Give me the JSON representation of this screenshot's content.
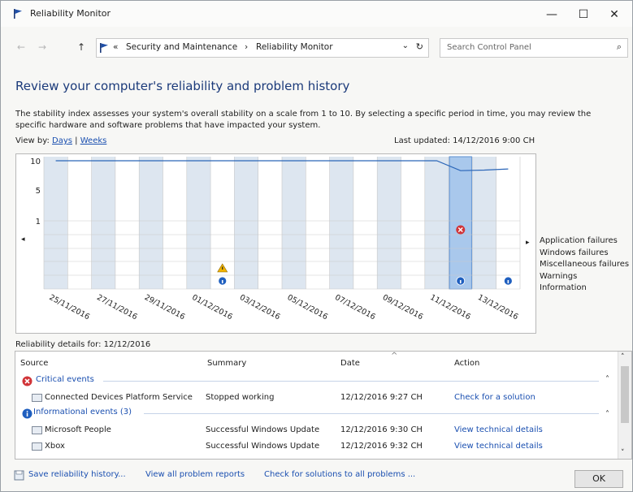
{
  "window": {
    "title": "Reliability Monitor",
    "minimize_glyph": "—",
    "maximize_glyph": "☐",
    "close_glyph": "✕"
  },
  "address": {
    "back_glyph": "←",
    "forward_glyph": "→",
    "up_glyph": "↑",
    "overflow": "«",
    "crumb1": "Security and Maintenance",
    "sep": "›",
    "crumb2": "Reliability Monitor",
    "dropdown_glyph": "⌄",
    "refresh_glyph": "↻",
    "search_placeholder": "Search Control Panel",
    "search_glyph": "⌕"
  },
  "page": {
    "heading": "Review your computer's reliability and problem history",
    "description": "The stability index assesses your system's overall stability on a scale from 1 to 10. By selecting a specific period in time, you may review the specific hardware and software problems that have impacted your system.",
    "view_by": "View by:",
    "days": "Days",
    "weeks": "Weeks",
    "sep": "|",
    "last_updated": "Last updated: 14/12/2016 9:00 CH"
  },
  "chart_data": {
    "type": "line",
    "y_ticks": [
      "10",
      "5",
      "1"
    ],
    "x_labels": [
      "25/11/2016",
      "27/11/2016",
      "29/11/2016",
      "01/12/2016",
      "03/12/2016",
      "05/12/2016",
      "07/12/2016",
      "09/12/2016",
      "11/12/2016",
      "13/12/2016"
    ],
    "num_days": 20,
    "stability": [
      10,
      10,
      10,
      10,
      10,
      10,
      10,
      10,
      10,
      10,
      10,
      10,
      10,
      10,
      10,
      10,
      10,
      8.3,
      8.4,
      8.6
    ],
    "selected_day_index": 17,
    "row_labels": [
      "Application failures",
      "Windows failures",
      "Miscellaneous failures",
      "Warnings",
      "Information"
    ],
    "events": [
      {
        "day": 7,
        "row": "Warnings",
        "kind": "warning"
      },
      {
        "day": 7,
        "row": "Information",
        "kind": "info"
      },
      {
        "day": 17,
        "row": "Application failures",
        "kind": "critical"
      },
      {
        "day": 17,
        "row": "Information",
        "kind": "info"
      },
      {
        "day": 19,
        "row": "Information",
        "kind": "info"
      }
    ],
    "colors": {
      "line": "#2b66b8",
      "shade": "#dde6f0",
      "selected": "#a9c8ec",
      "grid": "#c9c9c9"
    },
    "nav_left": "◂",
    "nav_right": "▸"
  },
  "details": {
    "label": "Reliability details for: 12/12/2016",
    "headers": {
      "source": "Source",
      "summary": "Summary",
      "date": "Date",
      "action": "Action"
    },
    "sort_glyph": "^",
    "critical_group": "Critical events",
    "info_group": "Informational events (3)",
    "collapse_glyph": "˄",
    "rows": [
      {
        "source": "Connected Devices Platform Service",
        "summary": "Stopped working",
        "date": "12/12/2016 9:27 CH",
        "action": "Check for a solution"
      },
      {
        "source": "Microsoft People",
        "summary": "Successful Windows Update",
        "date": "12/12/2016 9:30 CH",
        "action": "View  technical details"
      },
      {
        "source": "Xbox",
        "summary": "Successful Windows Update",
        "date": "12/12/2016 9:32 CH",
        "action": "View  technical details"
      }
    ],
    "scroll_up": "˄",
    "scroll_down": "˅"
  },
  "bottom": {
    "save": "Save reliability history...",
    "view_all": "View all problem reports",
    "check": "Check for solutions to all problems ...",
    "ok": "OK"
  }
}
